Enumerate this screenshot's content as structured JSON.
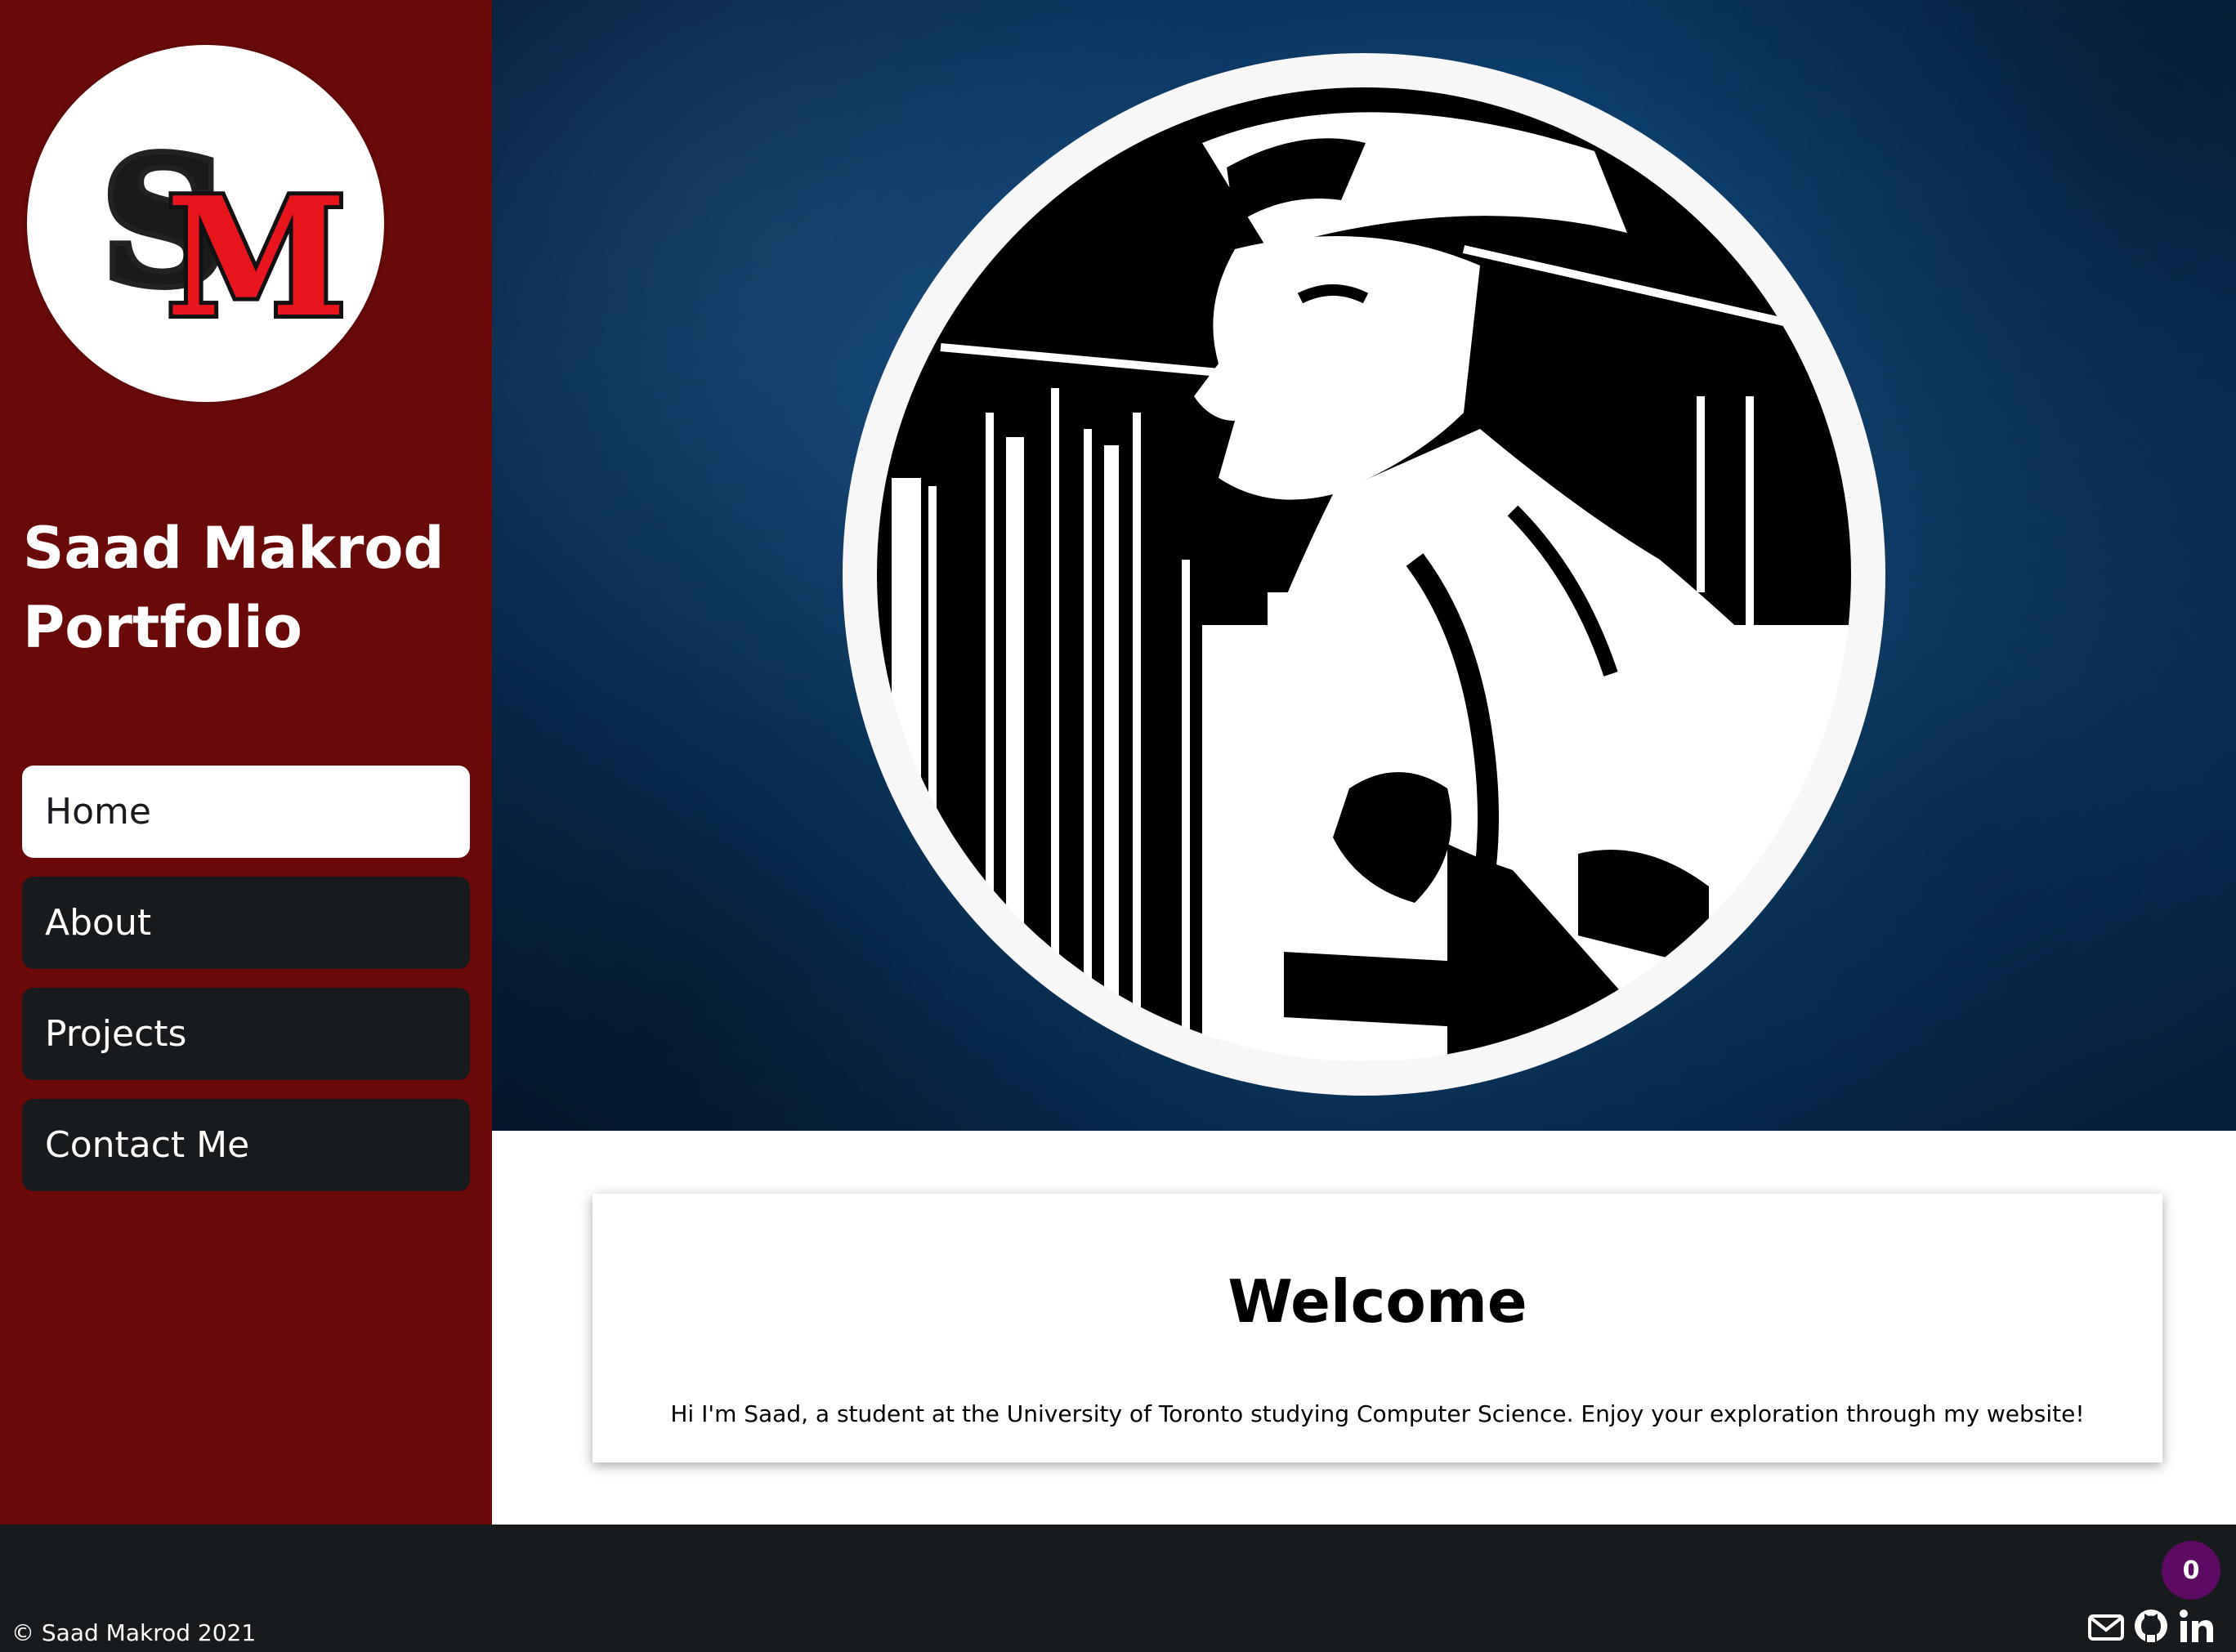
{
  "sidebar": {
    "logo_text": "SM",
    "title_line1": "Saad Makrod",
    "title_line2": "Portfolio",
    "nav": [
      {
        "label": "Home",
        "active": true
      },
      {
        "label": "About",
        "active": false
      },
      {
        "label": "Projects",
        "active": false
      },
      {
        "label": "Contact Me",
        "active": false
      }
    ]
  },
  "hero": {
    "background_color": "#0f4576",
    "portrait_icon": "portrait-sketch"
  },
  "welcome": {
    "title": "Welcome",
    "text": "Hi I'm Saad, a student at the University of Toronto studying Computer Science. Enjoy your exploration through my website!"
  },
  "footer": {
    "copyright": "© Saad Makrod 2021",
    "badge_count": "0",
    "social_icons": [
      "mail-icon",
      "github-icon",
      "linkedin-icon"
    ]
  },
  "colors": {
    "sidebar": "#690a09",
    "nav_item": "#181b1e",
    "footer": "#181b1e",
    "badge": "#5c0a62",
    "logo_red": "#e8161c"
  }
}
